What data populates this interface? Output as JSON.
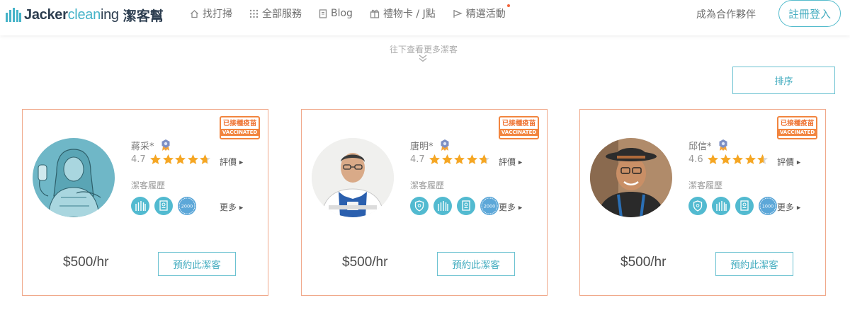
{
  "brand": {
    "name_bold": "Jacker",
    "name_accent": "clean",
    "name_tail": "ing",
    "name_zh": "潔客幫",
    "primary_color": "#45b3c8",
    "accent_color": "#f2853f"
  },
  "nav": [
    {
      "label": "找打掃",
      "icon": "home-icon"
    },
    {
      "label": "全部服務",
      "icon": "grid-dots-icon"
    },
    {
      "label": "Blog",
      "icon": "document-icon"
    },
    {
      "label": "禮物卡 / J點",
      "icon": "gift-icon"
    },
    {
      "label": "精選活動",
      "icon": "flag-icon",
      "has_notification_dot": true
    }
  ],
  "header": {
    "partner_link": "成為合作夥伴",
    "login_button": "註冊登入"
  },
  "scroll_hint": "往下查看更多潔客",
  "sort_button": "排序",
  "labels": {
    "vaccinated_zh": "已接種疫苗",
    "vaccinated_en": "VACCINATED",
    "review": "評價",
    "history": "潔客履歷",
    "more": "更多",
    "book": "預約此潔客"
  },
  "cleaners": [
    {
      "name": "蔣采*",
      "rating": "4.7",
      "stars": 4.7,
      "price": "$500/hr",
      "badges": [
        "building-icon",
        "certificate-icon",
        "2000"
      ],
      "badge_texts": [
        "",
        "",
        "2000"
      ]
    },
    {
      "name": "唐明*",
      "rating": "4.7",
      "stars": 4.7,
      "price": "$500/hr",
      "badges": [
        "shield-icon",
        "building-icon",
        "certificate-icon",
        "2000"
      ],
      "badge_texts": [
        "",
        "",
        "",
        "2000"
      ]
    },
    {
      "name": "邱信*",
      "rating": "4.6",
      "stars": 4.6,
      "price": "$500/hr",
      "badges": [
        "shield-icon",
        "building-icon",
        "certificate-icon",
        "1000"
      ],
      "badge_texts": [
        "",
        "",
        "",
        "1000"
      ]
    }
  ]
}
